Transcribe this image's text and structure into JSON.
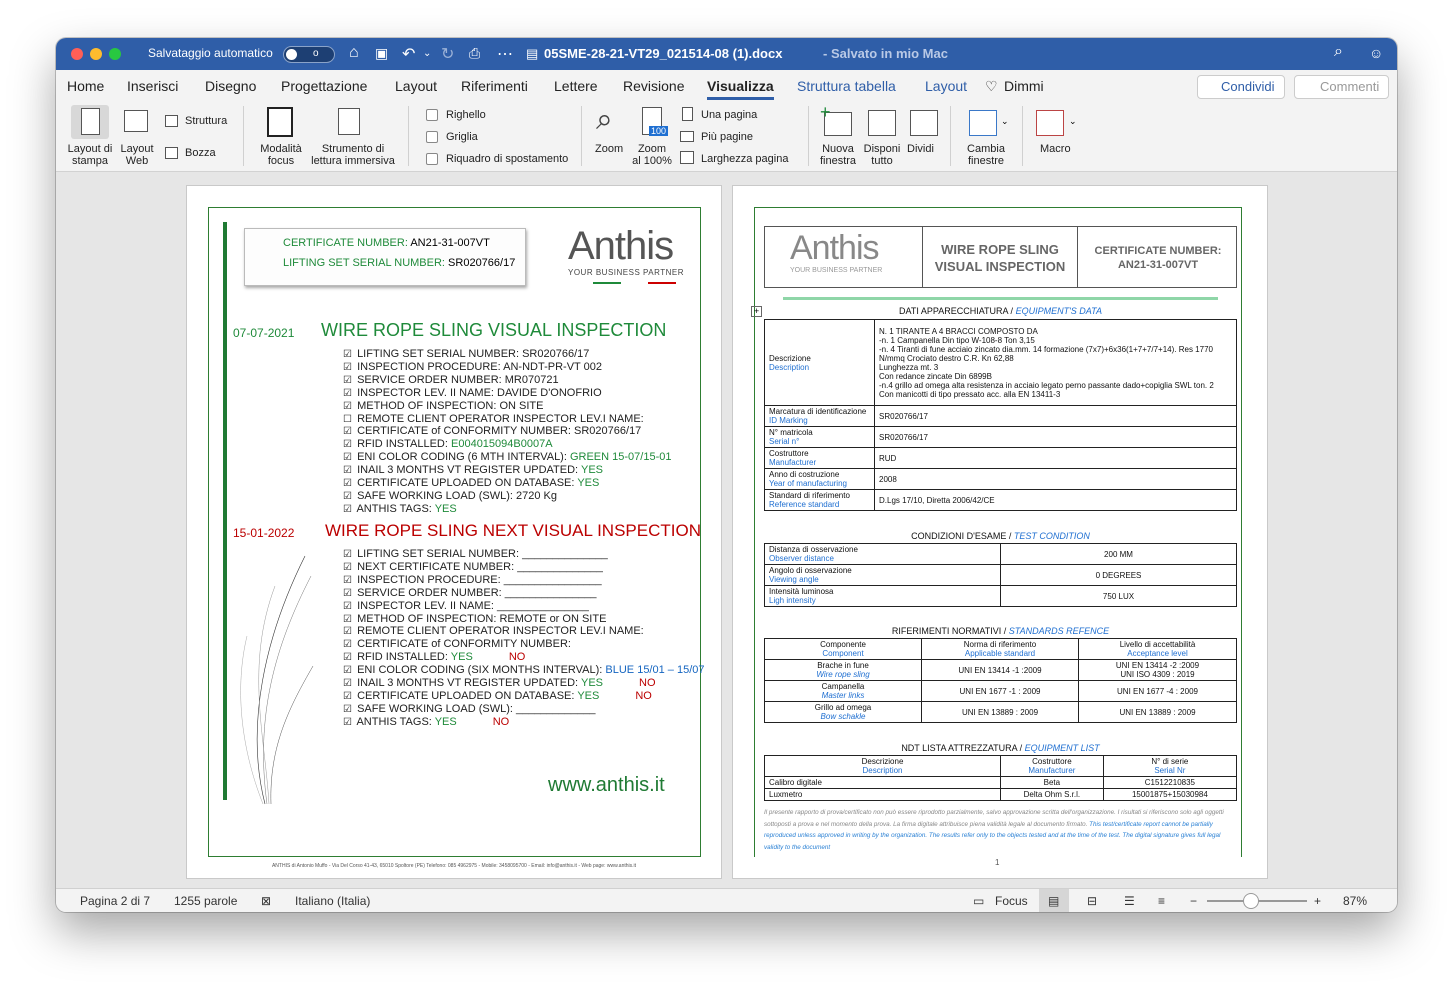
{
  "titlebar": {
    "autosave": "Salvataggio automatico",
    "toggle": "o",
    "filename": "05SME-28-21-VT29_021514-08 (1).docx",
    "saved": "- Salvato in mio Mac"
  },
  "tabs": [
    "Home",
    "Inserisci",
    "Disegno",
    "Progettazione",
    "Layout",
    "Riferimenti",
    "Lettere",
    "Revisione",
    "Visualizza",
    "Struttura tabella",
    "Layout",
    "Dimmi"
  ],
  "share": "Condividi",
  "comments": "Commenti",
  "ribbon": {
    "print_layout": [
      "Layout di",
      "stampa"
    ],
    "web_layout": [
      "Layout",
      "Web"
    ],
    "outline": "Struttura",
    "draft": "Bozza",
    "focus": [
      "Modalità",
      "focus"
    ],
    "immersive": [
      "Strumento di",
      "lettura immersiva"
    ],
    "ruler": "Righello",
    "grid": "Griglia",
    "nav": "Riquadro di spostamento",
    "zoom": "Zoom",
    "zoom100": [
      "Zoom",
      "al 100%"
    ],
    "zoom100_badge": "100",
    "one_page": "Una pagina",
    "multi_page": "Più pagine",
    "page_width": "Larghezza pagina",
    "new_window": [
      "Nuova",
      "finestra"
    ],
    "arrange": [
      "Disponi",
      "tutto"
    ],
    "split": "Dividi",
    "switch": [
      "Cambia",
      "finestre"
    ],
    "macro": "Macro"
  },
  "page1": {
    "cert_label": "CERTIFICATE NUMBER:",
    "cert_value": "AN21-31-007VT",
    "lifting_label": "LIFTING SET SERIAL NUMBER:",
    "lifting_value": "SR020766/17",
    "logo": "Anthis",
    "tagline": "YOUR BUSINESS PARTNER",
    "date1": "07-07-2021",
    "title1": "WIRE ROPE SLING VISUAL INSPECTION",
    "list1": [
      {
        "ck": "☑",
        "t": "LIFTING SET SERIAL NUMBER: SR020766/17",
        "a": "",
        "ac": ""
      },
      {
        "ck": "☑",
        "t": "INSPECTION PROCEDURE: AN-NDT-PR-VT 002",
        "a": "",
        "ac": ""
      },
      {
        "ck": "☑",
        "t": "SERVICE ORDER NUMBER: MR070721",
        "a": "",
        "ac": ""
      },
      {
        "ck": "☑",
        "t": "INSPECTOR LEV. II NAME: DAVIDE D'ONOFRIO",
        "a": "",
        "ac": ""
      },
      {
        "ck": "☑",
        "t": "METHOD OF INSPECTION: ON SITE",
        "a": "",
        "ac": ""
      },
      {
        "ck": "☐",
        "t": "REMOTE CLIENT OPERATOR INSPECTOR LEV.I NAME:",
        "a": "",
        "ac": ""
      },
      {
        "ck": "☑",
        "t": "CERTIFICATE of CONFORMITY NUMBER: SR020766/17",
        "a": "",
        "ac": ""
      },
      {
        "ck": "☑",
        "t": "RFID INSTALLED: ",
        "a": "E004015094B0007A",
        "ac": "green"
      },
      {
        "ck": "☑",
        "t": "ENI COLOR CODING (6 MTH INTERVAL): ",
        "a": "GREEN 15-07/15-01",
        "ac": "green"
      },
      {
        "ck": "☑",
        "t": "INAIL 3 MONTHS VT REGISTER UPDATED: ",
        "a": "YES",
        "ac": "green"
      },
      {
        "ck": "☑",
        "t": "CERTIFICATE UPLOADED ON DATABASE: ",
        "a": "YES",
        "ac": "green"
      },
      {
        "ck": "☑",
        "t": "SAFE WORKING LOAD (SWL): 2720 Kg",
        "a": "",
        "ac": ""
      },
      {
        "ck": "☑",
        "t": "ANTHIS TAGS: ",
        "a": "YES",
        "ac": "green"
      }
    ],
    "date2": "15-01-2022",
    "title2": "WIRE ROPE SLING NEXT VISUAL INSPECTION",
    "list2": [
      {
        "t": "LIFTING SET SERIAL NUMBER: ______________",
        "a": "",
        "b": ""
      },
      {
        "t": "NEXT CERTIFICATE NUMBER: ______________",
        "a": "",
        "b": ""
      },
      {
        "t": "INSPECTION PROCEDURE: ________________",
        "a": "",
        "b": ""
      },
      {
        "t": "SERVICE ORDER NUMBER: _______________",
        "a": "",
        "b": ""
      },
      {
        "t": "INSPECTOR LEV. II NAME: _______________",
        "a": "",
        "b": ""
      },
      {
        "t": "METHOD OF INSPECTION:   REMOTE or ON SITE",
        "a": "",
        "b": ""
      },
      {
        "t": "REMOTE CLIENT OPERATOR INSPECTOR LEV.I NAME:",
        "a": "",
        "b": ""
      },
      {
        "t": "CERTIFICATE of CONFORMITY NUMBER:",
        "a": "",
        "b": ""
      },
      {
        "t": "RFID INSTALLED: ",
        "a": "YES",
        "b": "NO"
      },
      {
        "t": "ENI COLOR CODING (SIX MONTHS INTERVAL): ",
        "a": "BLUE 15/01 – 15/07",
        "b": ""
      },
      {
        "t": "INAIL 3 MONTHS VT REGISTER UPDATED: ",
        "a": "YES",
        "b": "NO"
      },
      {
        "t": "CERTIFICATE UPLOADED ON DATABASE: ",
        "a": "YES",
        "b": "NO"
      },
      {
        "t": "SAFE WORKING LOAD (SWL): _____________",
        "a": "",
        "b": ""
      },
      {
        "t": "ANTHIS TAGS: ",
        "a": "YES",
        "b": "NO"
      }
    ],
    "website": "www.anthis.it",
    "footer": "ANTHIS di Antonio Muffo - Via Del Corso 41-43, 65010 Spoltore (PE) Telefono: 085 4962975 - Mobile: 3458095700 - Email: info@anthis.it - Web page: www.anthis.it"
  },
  "page2": {
    "logo": "Anthis",
    "tagline": "YOUR BUSINESS PARTNER",
    "header_title": [
      "WIRE ROPE SLING",
      "VISUAL INSPECTION"
    ],
    "header_cert": [
      "CERTIFICATE NUMBER:",
      "AN21-31-007VT"
    ],
    "s1": {
      "it": "DATI APPARECCHIATURA / ",
      "en": "EQUIPMENT'S DATA"
    },
    "equip": [
      {
        "it": "Descrizione",
        "en": "Description",
        "v": [
          "N. 1 TIRANTE A 4 BRACCI COMPOSTO DA",
          "-n. 1 Campanella Din tipo W-108-8 Ton 3,15",
          "-n. 4 Tiranti di fune acciaio zincato dia.mm. 14 formazione (7x7)+6x36(1+7+7/7+14). Res 1770",
          "N/mmq Crociato destro C.R. Kn 62,88",
          "Lunghezza mt. 3",
          "Con redance zincate Din 6899B",
          "-n.4 grillo ad omega alta resistenza in acciaio legato perno passante dado+copiglia SWL ton. 2",
          "Con manicotti di tipo pressato acc. alla EN 13411-3"
        ]
      },
      {
        "it": "Marcatura di identificazione",
        "en": "ID Marking",
        "v": [
          "SR020766/17"
        ]
      },
      {
        "it": "N° matricola",
        "en": "Serial n°",
        "v": [
          "SR020766/17"
        ]
      },
      {
        "it": "Costruttore",
        "en": "Manufacturer",
        "v": [
          "RUD"
        ]
      },
      {
        "it": "Anno di costruzione",
        "en": "Year of manufacturing",
        "v": [
          "2008"
        ]
      },
      {
        "it": "Standard di riferimento",
        "en": "Reference standard",
        "v": [
          "D.Lgs 17/10, Diretta 2006/42/CE"
        ]
      }
    ],
    "s2": {
      "it": "CONDIZIONI D'ESAME / ",
      "en": "TEST CONDITION"
    },
    "cond": [
      {
        "it": "Distanza di osservazione",
        "en": "Observer distance",
        "v": "200 MM"
      },
      {
        "it": "Angolo di osservazione",
        "en": "Viewing angle",
        "v": "0 DEGREES"
      },
      {
        "it": "Intensità luminosa",
        "en": "Ligh intensity",
        "v": "750 LUX"
      }
    ],
    "s3": {
      "it": "RIFERIMENTI NORMATIVI / ",
      "en": "STANDARDS REFENCE"
    },
    "std_head": [
      {
        "it": "Componente",
        "en": "Component"
      },
      {
        "it": "Norma di riferimento",
        "en": "Applicable standard"
      },
      {
        "it": "Livello di accettabilità",
        "en": "Acceptance level"
      }
    ],
    "std": [
      {
        "it": "Brache in fune",
        "en": "Wire rope sling",
        "n": "UNI EN 13414 -1 :2009",
        "l": [
          "UNI EN 13414 -2 :2009",
          "UNI ISO 4309 : 2019"
        ]
      },
      {
        "it": "Campanella",
        "en": "Master links",
        "n": "UNI EN 1677 -1 : 2009",
        "l": [
          "UNI EN 1677 -4 : 2009"
        ]
      },
      {
        "it": "Grillo ad omega",
        "en": "Bow schakle",
        "n": "UNI EN 13889 : 2009",
        "l": [
          "UNI EN 13889 : 2009"
        ]
      }
    ],
    "s4": {
      "it": "NDT LISTA ATTREZZATURA / ",
      "en": "EQUIPMENT LIST"
    },
    "eq_head": [
      {
        "it": "Descrizione",
        "en": "Description"
      },
      {
        "it": "Costruttore",
        "en": "Manufacturer"
      },
      {
        "it": "N° di serie",
        "en": "Serial Nr"
      }
    ],
    "eq": [
      {
        "d": "Calibro digitale",
        "m": "Beta",
        "s": "C1512210835"
      },
      {
        "d": "Luxmetro",
        "m": "Delta Ohm S.r.l.",
        "s": "15001875+15030984"
      }
    ],
    "disclaimer_it": "Il presente rapporto di prova/certificato non può essere riprodotto parzialmente, salvo approvazione scritta dell'organizzazione. I risultati si riferiscono solo agli oggetti sottoposti a prova e nel momento della prova. La firma digitale attribuisce piena validità legale al documento firmato.",
    "disclaimer_en": "This test/certificate report cannot be partially reproduced unless approved in writing by the organization. The results refer only to the objects tested and at the time of the test. The digital signature gives full legal validity to the document",
    "page_number": "1"
  },
  "status": {
    "page": "Pagina 2 di 7",
    "words": "1255 parole",
    "lang": "Italiano (Italia)",
    "focus": "Focus",
    "zoom": "87%",
    "zoom_level": 0.44
  },
  "colors": {
    "title_bar": "#2f5ea8",
    "green": "#1f8a3a",
    "red": "#b00000",
    "blue": "#1565c0"
  }
}
